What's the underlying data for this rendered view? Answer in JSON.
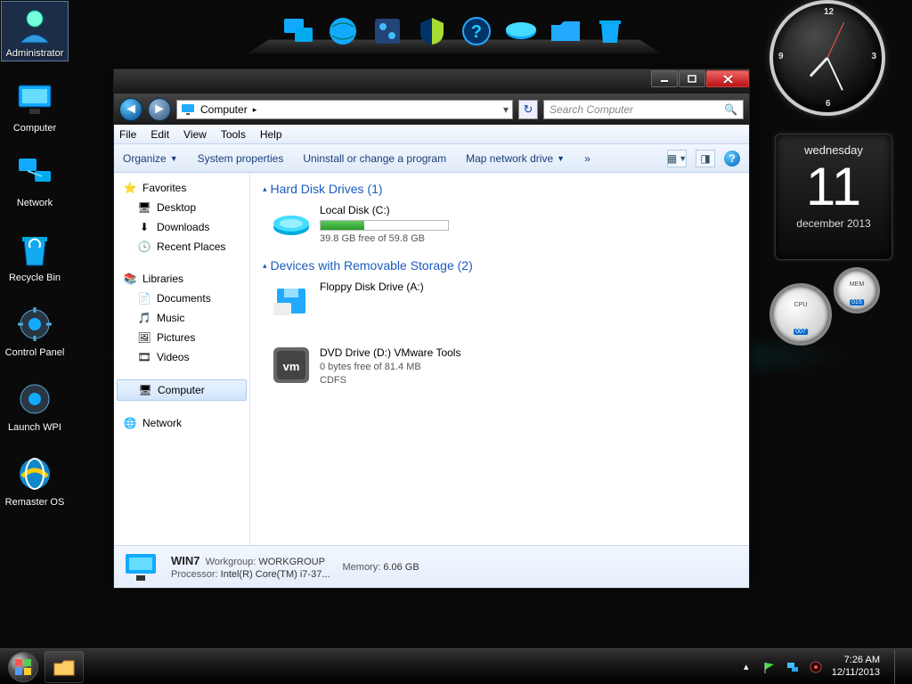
{
  "desktop": {
    "icons": [
      {
        "label": "Administrator",
        "selected": true
      },
      {
        "label": "Computer"
      },
      {
        "label": "Network"
      },
      {
        "label": "Recycle Bin"
      },
      {
        "label": "Control Panel"
      },
      {
        "label": "Launch WPI"
      },
      {
        "label": "Remaster OS"
      }
    ]
  },
  "calendar": {
    "weekday": "wednesday",
    "day": "11",
    "month_year": "december 2013"
  },
  "cpu_gadget": {
    "cpu_label": "CPU",
    "cpu_val": "007",
    "mem_label": "MEM",
    "mem_val": "015"
  },
  "explorer": {
    "breadcrumb": {
      "root": "Computer",
      "sep": "▸"
    },
    "search_placeholder": "Search Computer",
    "menus": [
      "File",
      "Edit",
      "View",
      "Tools",
      "Help"
    ],
    "commands": {
      "organize": "Organize",
      "sysprop": "System properties",
      "uninstall": "Uninstall or change a program",
      "mapdrive": "Map network drive"
    },
    "nav": {
      "favorites": {
        "head": "Favorites",
        "items": [
          "Desktop",
          "Downloads",
          "Recent Places"
        ]
      },
      "libraries": {
        "head": "Libraries",
        "items": [
          "Documents",
          "Music",
          "Pictures",
          "Videos"
        ]
      },
      "computer": "Computer",
      "network": "Network"
    },
    "categories": {
      "hdd": "Hard Disk Drives (1)",
      "removable": "Devices with Removable Storage (2)"
    },
    "drives": {
      "c": {
        "name": "Local Disk (C:)",
        "free": "39.8 GB free of 59.8 GB",
        "fill_pct": 34
      },
      "a": {
        "name": "Floppy Disk Drive (A:)"
      },
      "d": {
        "name": "DVD Drive (D:) VMware Tools",
        "free": "0 bytes free of 81.4 MB",
        "fs": "CDFS"
      }
    },
    "details": {
      "name": "WIN7",
      "workgroup_label": "Workgroup:",
      "workgroup": "WORKGROUP",
      "processor_label": "Processor:",
      "processor": "Intel(R) Core(TM) i7-37...",
      "memory_label": "Memory:",
      "memory": "6.06 GB"
    }
  },
  "taskbar": {
    "time": "7:26 AM",
    "date": "12/11/2013"
  }
}
